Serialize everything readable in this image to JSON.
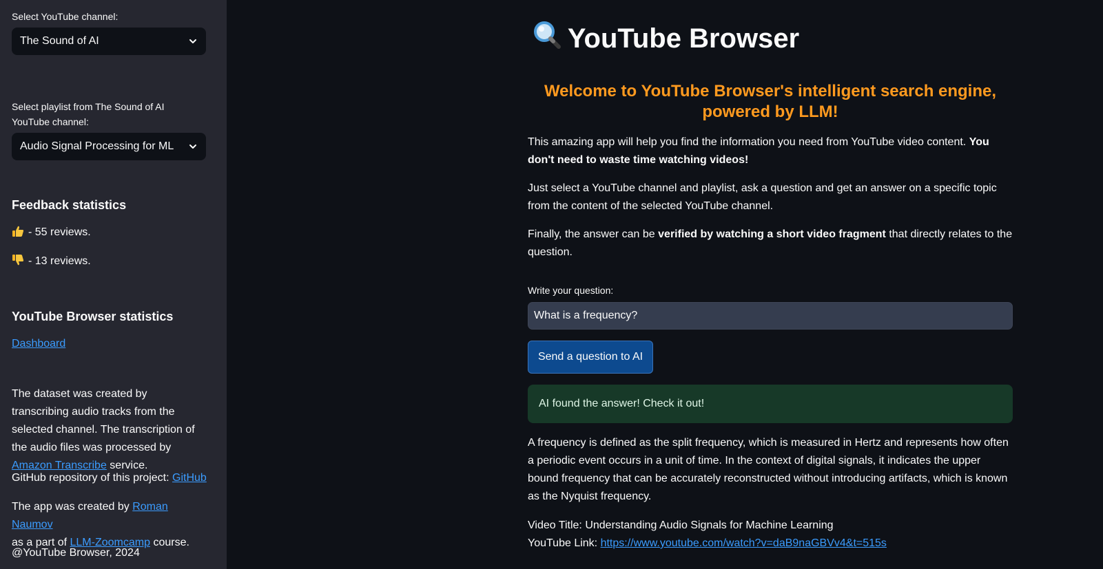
{
  "sidebar": {
    "channel_label": "Select YouTube channel:",
    "channel_value": "The Sound of AI",
    "playlist_label": "Select playlist from The Sound of AI YouTube channel:",
    "playlist_value": "Audio Signal Processing for ML",
    "feedback_heading": "Feedback statistics",
    "thumbs_up_text": "- 55 reviews.",
    "thumbs_down_text": "- 13 reviews.",
    "browser_stats_heading": "YouTube Browser statistics",
    "dashboard_link": "Dashboard",
    "dataset_text_1": "The dataset was created by transcribing audio tracks from the selected channel. The transcription of the audio files was processed by",
    "dataset_link": "Amazon Transcribe",
    "dataset_text_2": "service.",
    "github_text": "GitHub repository of this project:",
    "github_link": "GitHub",
    "created_text_1": "The app was created by",
    "author_link": "Roman Naumov",
    "created_text_2": "as a part of",
    "course_link": "LLM-Zoomcamp",
    "created_text_3": "course.",
    "copyright": "@YouTube Browser, 2024"
  },
  "main": {
    "title": "YouTube Browser",
    "title_icon": "magnifier-icon",
    "welcome": "Welcome to YouTube Browser's intelligent search engine, powered by LLM!",
    "p1_normal": "This amazing app will help you find the information you need from YouTube video content.",
    "p1_bold": "You don't need to waste time watching videos!",
    "p2": "Just select a YouTube channel and playlist, ask a question and get an answer on a specific topic from the content of the selected YouTube channel.",
    "p3_a": "Finally, the answer can be",
    "p3_bold": "verified by watching a short video fragment",
    "p3_b": "that directly relates to the question.",
    "question_label": "Write your question:",
    "question_value": "What is a frequency?",
    "send_button": "Send a question to AI",
    "success_text": "AI found the answer! Check it out!",
    "answer": "A frequency is defined as the split frequency, which is measured in Hertz and represents how often a periodic event occurs in a unit of time. In the context of digital signals, it indicates the upper bound frequency that can be accurately reconstructed without introducing artifacts, which is known as the Nyquist frequency.",
    "video_title_label": "Video Title: Understanding Audio Signals for Machine Learning",
    "youtube_link_label": "YouTube Link:",
    "youtube_link": "https://www.youtube.com/watch?v=daB9naGBVv4&t=515s"
  },
  "colors": {
    "accent_orange": "#ff9a1f",
    "link_blue": "#3b9cff",
    "success_bg": "#173928",
    "button_bg": "#0d4a8f"
  }
}
